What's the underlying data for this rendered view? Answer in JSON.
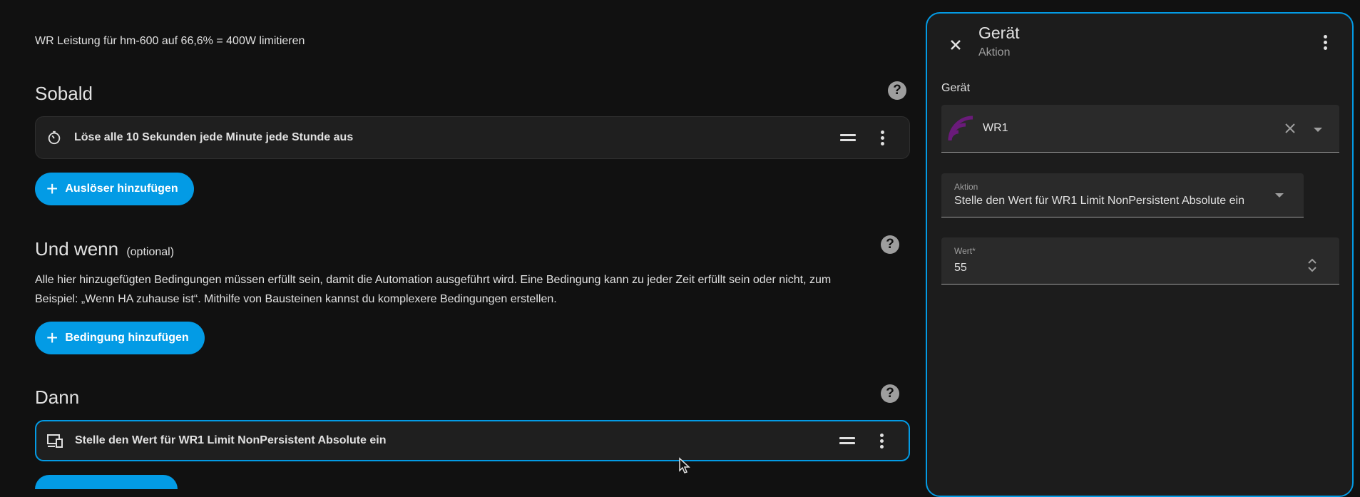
{
  "description": "WR Leistung für hm-600 auf 66,6% = 400W limitieren",
  "sections": {
    "triggers": {
      "title": "Sobald",
      "row_label": "Löse alle 10 Sekunden jede Minute jede Stunde aus",
      "add_button": "Auslöser hinzufügen"
    },
    "conditions": {
      "title": "Und wenn",
      "optional": "(optional)",
      "paragraph_line1": "Alle hier hinzugefügten Bedingungen müssen erfüllt sein, damit die Automation ausgeführt wird. Eine Bedingung kann zu jeder Zeit erfüllt sein oder nicht, zum",
      "paragraph_line2": "Beispiel: „Wenn HA zuhause ist“. Mithilfe von Bausteinen kannst du komplexere Bedingungen erstellen.",
      "add_button": "Bedingung hinzufügen"
    },
    "actions": {
      "title": "Dann",
      "row_label": "Stelle den Wert für WR1 Limit NonPersistent Absolute ein"
    }
  },
  "panel": {
    "title": "Gerät",
    "subtitle": "Aktion",
    "device_label": "Gerät",
    "device_value": "WR1",
    "action_small_label": "Aktion",
    "action_value": "Stelle den Wert für WR1 Limit NonPersistent Absolute ein",
    "value_small_label": "Wert*",
    "value": "55"
  },
  "colors": {
    "accent": "#039be5",
    "background": "#111111",
    "device_icon": "#6a1b7a"
  },
  "icons": [
    "timer-icon",
    "help-icon",
    "drag-handle-icon",
    "more-vert-icon",
    "plus-icon",
    "device-icon",
    "close-icon",
    "clear-icon",
    "chevron-down-icon",
    "stepper-icon",
    "wifi-signal-icon"
  ]
}
